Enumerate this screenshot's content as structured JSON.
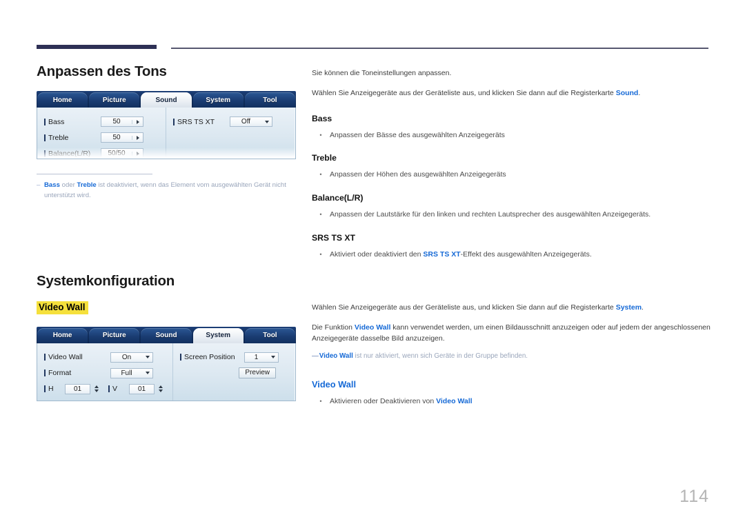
{
  "page": {
    "number": "114"
  },
  "sections": [
    {
      "heading": "Anpassen des Tons",
      "ui": {
        "tabs": [
          {
            "label": "Home",
            "active": false
          },
          {
            "label": "Picture",
            "active": false
          },
          {
            "label": "Sound",
            "active": true
          },
          {
            "label": "System",
            "active": false
          },
          {
            "label": "Tool",
            "active": false
          }
        ],
        "left_rows": [
          {
            "label": "Bass",
            "value": "50",
            "control": "stepper-right"
          },
          {
            "label": "Treble",
            "value": "50",
            "control": "stepper-right"
          },
          {
            "label": "Balance(L/R)",
            "value": "50/50",
            "control": "stepper-right"
          }
        ],
        "right_rows": [
          {
            "label": "SRS TS XT",
            "value": "Off",
            "control": "dropdown"
          }
        ]
      },
      "footnote": {
        "dash": "–",
        "term1": "Bass",
        "mid": " oder ",
        "term2": "Treble",
        "rest": " ist deaktiviert, wenn das Element vom ausgewählten Gerät nicht unterstützt wird."
      }
    },
    {
      "heading": "Systemkonfiguration",
      "highlight_label": "Video Wall",
      "ui": {
        "tabs": [
          {
            "label": "Home",
            "active": false
          },
          {
            "label": "Picture",
            "active": false
          },
          {
            "label": "Sound",
            "active": false
          },
          {
            "label": "System",
            "active": true
          },
          {
            "label": "Tool",
            "active": false
          }
        ],
        "left_rows": [
          {
            "label": "Video Wall",
            "value": "On",
            "control": "dropdown"
          },
          {
            "label": "Format",
            "value": "Full",
            "control": "dropdown"
          }
        ],
        "hv_row": {
          "h_label": "H",
          "h_value": "01",
          "v_label": "V",
          "v_value": "01"
        },
        "right_rows": [
          {
            "label": "Screen Position",
            "value": "1",
            "control": "dropdown"
          }
        ],
        "preview_button": "Preview"
      }
    }
  ],
  "right_column": {
    "sound": {
      "intro1": "Sie können die Toneinstellungen anpassen.",
      "intro2_pre": "Wählen Sie Anzeigegeräte aus der Geräteliste aus, und klicken Sie dann auf die Registerkarte ",
      "intro2_link": "Sound",
      "intro2_post": ".",
      "items": [
        {
          "title": "Bass",
          "bullet": "Anpassen der Bässe des ausgewählten Anzeigegeräts"
        },
        {
          "title": "Treble",
          "bullet": "Anpassen der Höhen des ausgewählten Anzeigegeräts"
        },
        {
          "title": "Balance(L/R)",
          "bullet": "Anpassen der Lautstärke für den linken und rechten Lautsprecher des ausgewählten Anzeigegeräts."
        }
      ],
      "srs": {
        "title": "SRS TS XT",
        "bullet_pre": "Aktiviert oder deaktiviert den ",
        "bullet_link": "SRS TS XT",
        "bullet_post": "-Effekt des ausgewählten Anzeigegeräts."
      }
    },
    "system": {
      "intro1_pre": "Wählen Sie Anzeigegeräte aus der Geräteliste aus, und klicken Sie dann auf die Registerkarte ",
      "intro1_link": "System",
      "intro1_post": ".",
      "intro2_pre": "Die Funktion ",
      "intro2_link": "Video Wall",
      "intro2_post": " kann verwendet werden, um einen Bildausschnitt anzuzeigen oder auf jedem der angeschlossenen Anzeigegeräte dasselbe Bild anzuzeigen.",
      "note_dash": "—",
      "note_link": "Video Wall",
      "note_rest": " ist nur aktiviert, wenn sich Geräte in der Gruppe befinden.",
      "item": {
        "title": "Video Wall",
        "bullet_pre": "Aktivieren oder Deaktivieren von ",
        "bullet_link": "Video Wall"
      }
    }
  }
}
